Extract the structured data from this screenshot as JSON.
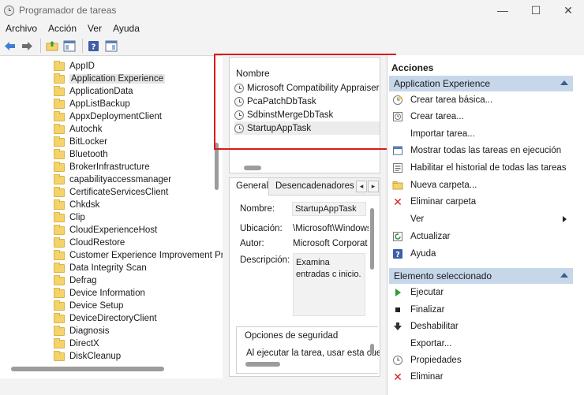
{
  "window": {
    "title": "Programador de tareas",
    "minimize_glyph": "—",
    "maximize_glyph": "☐",
    "close_glyph": "✕"
  },
  "menu": [
    "Archivo",
    "Acción",
    "Ver",
    "Ayuda"
  ],
  "toolbar": {
    "icons": [
      "back-arrow-icon",
      "forward-arrow-icon",
      "up-folder-icon",
      "show-hide-console-tree-icon",
      "help-icon",
      "show-hide-action-pane-icon"
    ]
  },
  "tree": {
    "items": [
      "AppID",
      "Application Experience",
      "ApplicationData",
      "AppListBackup",
      "AppxDeploymentClient",
      "Autochk",
      "BitLocker",
      "Bluetooth",
      "BrokerInfrastructure",
      "capabilityaccessmanager",
      "CertificateServicesClient",
      "Chkdsk",
      "Clip",
      "CloudExperienceHost",
      "CloudRestore",
      "Customer Experience Improvement Pro",
      "Data Integrity Scan",
      "Defrag",
      "Device Information",
      "Device Setup",
      "DeviceDirectoryClient",
      "Diagnosis",
      "DirectX",
      "DiskCleanup"
    ],
    "selected_index": 1
  },
  "tasklist": {
    "column_header": "Nombre",
    "tasks": [
      "Microsoft Compatibility Appraiser",
      "PcaPatchDbTask",
      "SdbinstMergeDbTask",
      "StartupAppTask"
    ],
    "selected_index": 3
  },
  "details": {
    "tabs": [
      "General",
      "Desencadenadores"
    ],
    "prev_arrow": "◂",
    "next_arrow": "▸",
    "name_label": "Nombre:",
    "name_value": "StartupAppTask",
    "location_label": "Ubicación:",
    "location_value": "\\Microsoft\\Windows",
    "author_label": "Autor:",
    "author_value": "Microsoft Corporat",
    "description_label": "Descripción:",
    "description_value": "Examina entradas c inicio.",
    "security_title": "Opciones de seguridad",
    "security_text": "Al ejecutar la tarea, usar esta cue"
  },
  "actions": {
    "title": "Acciones",
    "section1_title": "Application Experience",
    "section1_items": [
      {
        "label": "Crear tarea básica...",
        "icon": "create-basic-task-icon"
      },
      {
        "label": "Crear tarea...",
        "icon": "create-task-icon"
      },
      {
        "label": "Importar tarea...",
        "icon": "import-task-icon"
      },
      {
        "label": "Mostrar todas las tareas en ejecución",
        "icon": "show-running-tasks-icon"
      },
      {
        "label": "Habilitar el historial de todas las tareas",
        "icon": "enable-history-icon"
      },
      {
        "label": "Nueva carpeta...",
        "icon": "new-folder-icon"
      },
      {
        "label": "Eliminar carpeta",
        "icon": "delete-folder-icon"
      },
      {
        "label": "Ver",
        "icon": "view-icon"
      },
      {
        "label": "Actualizar",
        "icon": "refresh-icon"
      },
      {
        "label": "Ayuda",
        "icon": "help-icon"
      }
    ],
    "section2_title": "Elemento seleccionado",
    "section2_items": [
      {
        "label": "Ejecutar",
        "icon": "run-icon"
      },
      {
        "label": "Finalizar",
        "icon": "end-icon"
      },
      {
        "label": "Deshabilitar",
        "icon": "disable-icon"
      },
      {
        "label": "Exportar...",
        "icon": "export-icon"
      },
      {
        "label": "Propiedades",
        "icon": "properties-icon"
      },
      {
        "label": "Eliminar",
        "icon": "delete-icon"
      }
    ]
  },
  "colors": {
    "highlight_box": "#e01818",
    "section_header": "#c7d7ea",
    "folder": "#f4d36b"
  }
}
